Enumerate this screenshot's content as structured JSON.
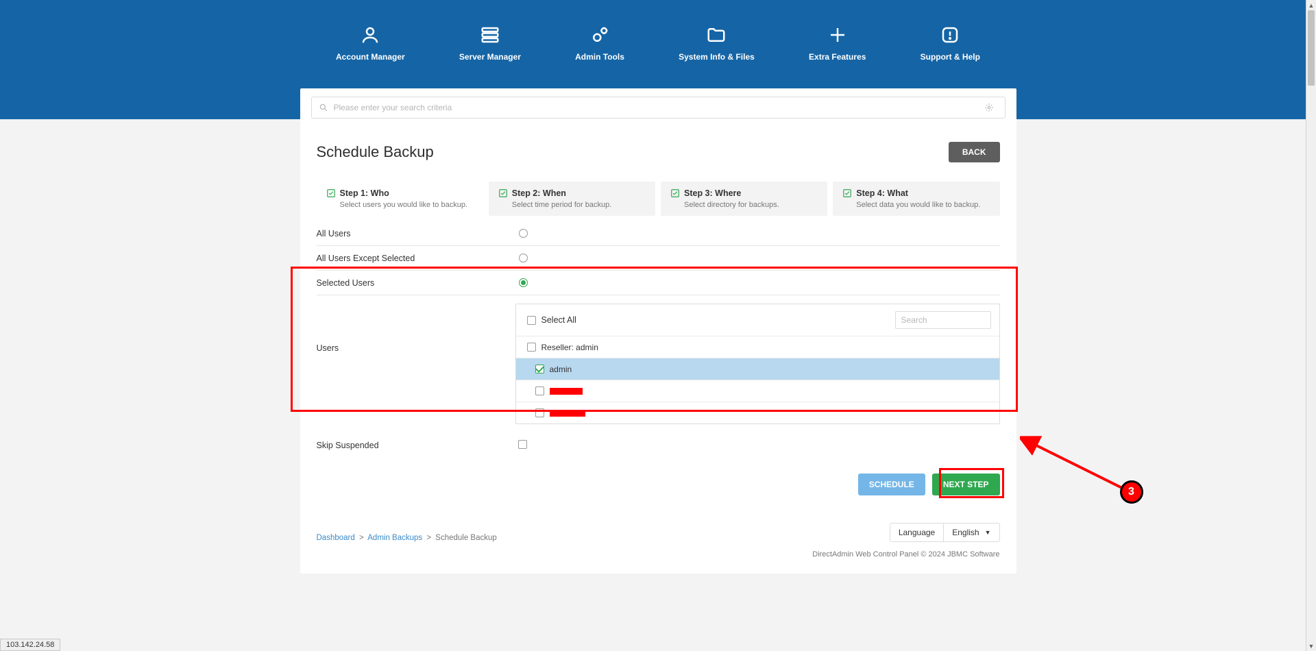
{
  "nav": [
    {
      "label": "Account Manager",
      "icon": "user"
    },
    {
      "label": "Server Manager",
      "icon": "server"
    },
    {
      "label": "Admin Tools",
      "icon": "gears"
    },
    {
      "label": "System Info & Files",
      "icon": "folder"
    },
    {
      "label": "Extra Features",
      "icon": "plus"
    },
    {
      "label": "Support & Help",
      "icon": "alert"
    }
  ],
  "search": {
    "placeholder": "Please enter your search criteria"
  },
  "page": {
    "title": "Schedule Backup",
    "back": "BACK"
  },
  "steps": [
    {
      "title": "Step 1: Who",
      "sub": "Select users you would like to backup."
    },
    {
      "title": "Step 2: When",
      "sub": "Select time period for backup."
    },
    {
      "title": "Step 3: Where",
      "sub": "Select directory for backups."
    },
    {
      "title": "Step 4: What",
      "sub": "Select data you would like to backup."
    }
  ],
  "radios": {
    "all": "All Users",
    "except": "All Users Except Selected",
    "selected": "Selected Users"
  },
  "users_block": {
    "label": "Users",
    "select_all": "Select All",
    "search_placeholder": "Search",
    "reseller": "Reseller: admin",
    "admin": "admin"
  },
  "skip": "Skip Suspended",
  "buttons": {
    "schedule": "SCHEDULE",
    "next": "NEXT STEP"
  },
  "footer": {
    "lang_label": "Language",
    "lang_value": "English",
    "copyright": "DirectAdmin Web Control Panel © 2024 JBMC Software"
  },
  "breadcrumbs": [
    {
      "text": "Dashboard",
      "link": true
    },
    {
      "text": "Admin Backups",
      "link": true
    },
    {
      "text": "Schedule Backup",
      "link": false
    }
  ],
  "status": "103.142.24.58",
  "annotation": {
    "badge": "3"
  }
}
